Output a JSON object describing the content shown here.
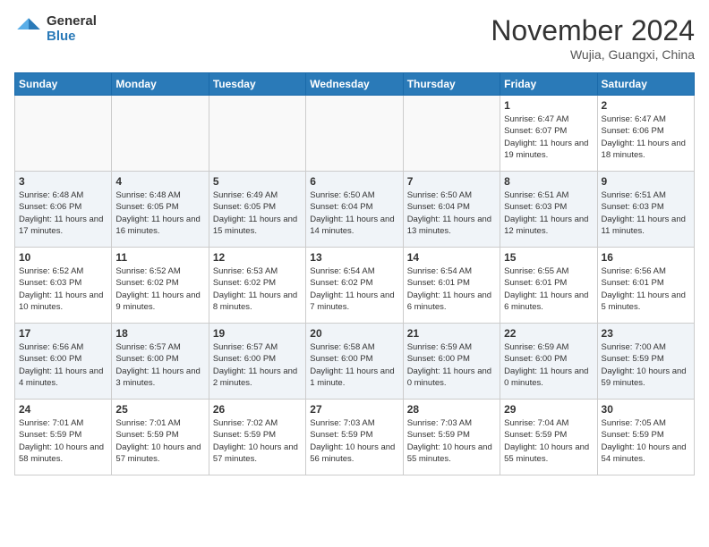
{
  "header": {
    "logo_general": "General",
    "logo_blue": "Blue",
    "month_title": "November 2024",
    "location": "Wujia, Guangxi, China"
  },
  "calendar": {
    "days_of_week": [
      "Sunday",
      "Monday",
      "Tuesday",
      "Wednesday",
      "Thursday",
      "Friday",
      "Saturday"
    ],
    "weeks": [
      [
        {
          "day": "",
          "detail": ""
        },
        {
          "day": "",
          "detail": ""
        },
        {
          "day": "",
          "detail": ""
        },
        {
          "day": "",
          "detail": ""
        },
        {
          "day": "",
          "detail": ""
        },
        {
          "day": "1",
          "detail": "Sunrise: 6:47 AM\nSunset: 6:07 PM\nDaylight: 11 hours and 19 minutes."
        },
        {
          "day": "2",
          "detail": "Sunrise: 6:47 AM\nSunset: 6:06 PM\nDaylight: 11 hours and 18 minutes."
        }
      ],
      [
        {
          "day": "3",
          "detail": "Sunrise: 6:48 AM\nSunset: 6:06 PM\nDaylight: 11 hours and 17 minutes."
        },
        {
          "day": "4",
          "detail": "Sunrise: 6:48 AM\nSunset: 6:05 PM\nDaylight: 11 hours and 16 minutes."
        },
        {
          "day": "5",
          "detail": "Sunrise: 6:49 AM\nSunset: 6:05 PM\nDaylight: 11 hours and 15 minutes."
        },
        {
          "day": "6",
          "detail": "Sunrise: 6:50 AM\nSunset: 6:04 PM\nDaylight: 11 hours and 14 minutes."
        },
        {
          "day": "7",
          "detail": "Sunrise: 6:50 AM\nSunset: 6:04 PM\nDaylight: 11 hours and 13 minutes."
        },
        {
          "day": "8",
          "detail": "Sunrise: 6:51 AM\nSunset: 6:03 PM\nDaylight: 11 hours and 12 minutes."
        },
        {
          "day": "9",
          "detail": "Sunrise: 6:51 AM\nSunset: 6:03 PM\nDaylight: 11 hours and 11 minutes."
        }
      ],
      [
        {
          "day": "10",
          "detail": "Sunrise: 6:52 AM\nSunset: 6:03 PM\nDaylight: 11 hours and 10 minutes."
        },
        {
          "day": "11",
          "detail": "Sunrise: 6:52 AM\nSunset: 6:02 PM\nDaylight: 11 hours and 9 minutes."
        },
        {
          "day": "12",
          "detail": "Sunrise: 6:53 AM\nSunset: 6:02 PM\nDaylight: 11 hours and 8 minutes."
        },
        {
          "day": "13",
          "detail": "Sunrise: 6:54 AM\nSunset: 6:02 PM\nDaylight: 11 hours and 7 minutes."
        },
        {
          "day": "14",
          "detail": "Sunrise: 6:54 AM\nSunset: 6:01 PM\nDaylight: 11 hours and 6 minutes."
        },
        {
          "day": "15",
          "detail": "Sunrise: 6:55 AM\nSunset: 6:01 PM\nDaylight: 11 hours and 6 minutes."
        },
        {
          "day": "16",
          "detail": "Sunrise: 6:56 AM\nSunset: 6:01 PM\nDaylight: 11 hours and 5 minutes."
        }
      ],
      [
        {
          "day": "17",
          "detail": "Sunrise: 6:56 AM\nSunset: 6:00 PM\nDaylight: 11 hours and 4 minutes."
        },
        {
          "day": "18",
          "detail": "Sunrise: 6:57 AM\nSunset: 6:00 PM\nDaylight: 11 hours and 3 minutes."
        },
        {
          "day": "19",
          "detail": "Sunrise: 6:57 AM\nSunset: 6:00 PM\nDaylight: 11 hours and 2 minutes."
        },
        {
          "day": "20",
          "detail": "Sunrise: 6:58 AM\nSunset: 6:00 PM\nDaylight: 11 hours and 1 minute."
        },
        {
          "day": "21",
          "detail": "Sunrise: 6:59 AM\nSunset: 6:00 PM\nDaylight: 11 hours and 0 minutes."
        },
        {
          "day": "22",
          "detail": "Sunrise: 6:59 AM\nSunset: 6:00 PM\nDaylight: 11 hours and 0 minutes."
        },
        {
          "day": "23",
          "detail": "Sunrise: 7:00 AM\nSunset: 5:59 PM\nDaylight: 10 hours and 59 minutes."
        }
      ],
      [
        {
          "day": "24",
          "detail": "Sunrise: 7:01 AM\nSunset: 5:59 PM\nDaylight: 10 hours and 58 minutes."
        },
        {
          "day": "25",
          "detail": "Sunrise: 7:01 AM\nSunset: 5:59 PM\nDaylight: 10 hours and 57 minutes."
        },
        {
          "day": "26",
          "detail": "Sunrise: 7:02 AM\nSunset: 5:59 PM\nDaylight: 10 hours and 57 minutes."
        },
        {
          "day": "27",
          "detail": "Sunrise: 7:03 AM\nSunset: 5:59 PM\nDaylight: 10 hours and 56 minutes."
        },
        {
          "day": "28",
          "detail": "Sunrise: 7:03 AM\nSunset: 5:59 PM\nDaylight: 10 hours and 55 minutes."
        },
        {
          "day": "29",
          "detail": "Sunrise: 7:04 AM\nSunset: 5:59 PM\nDaylight: 10 hours and 55 minutes."
        },
        {
          "day": "30",
          "detail": "Sunrise: 7:05 AM\nSunset: 5:59 PM\nDaylight: 10 hours and 54 minutes."
        }
      ]
    ]
  }
}
